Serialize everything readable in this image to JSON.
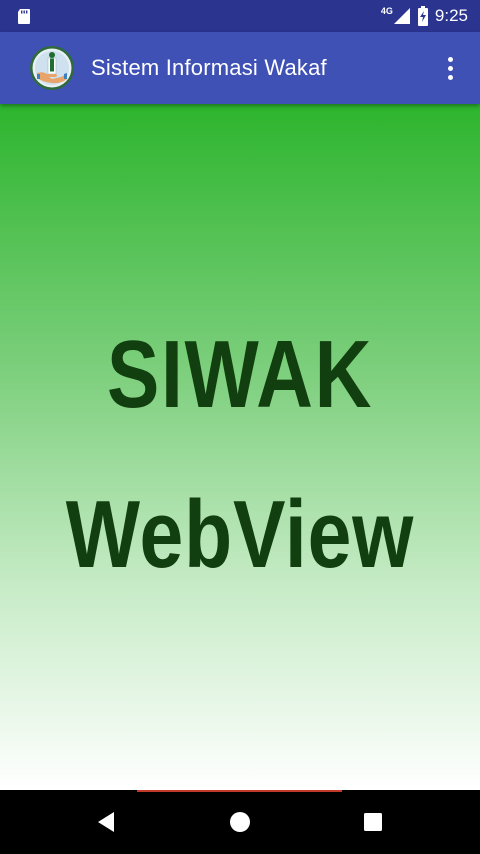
{
  "status_bar": {
    "network_label": "4G",
    "time": "9:25"
  },
  "app_bar": {
    "title": "Sistem Informasi Wakaf",
    "logo_icon": "wakaf-logo-icon",
    "menu_icon": "overflow-menu-icon"
  },
  "content": {
    "line1": "SIWAK",
    "line2": "WebView"
  },
  "navigation": {
    "back_icon": "back-triangle-icon",
    "home_icon": "home-circle-icon",
    "recents_icon": "recents-square-icon"
  },
  "colors": {
    "status_bar": "#2b3590",
    "app_bar": "#3f51b5",
    "gradient_top": "#2db52d",
    "gradient_bottom": "#ffffff",
    "splash_text": "#123f0f",
    "nav_bar": "#000000"
  }
}
